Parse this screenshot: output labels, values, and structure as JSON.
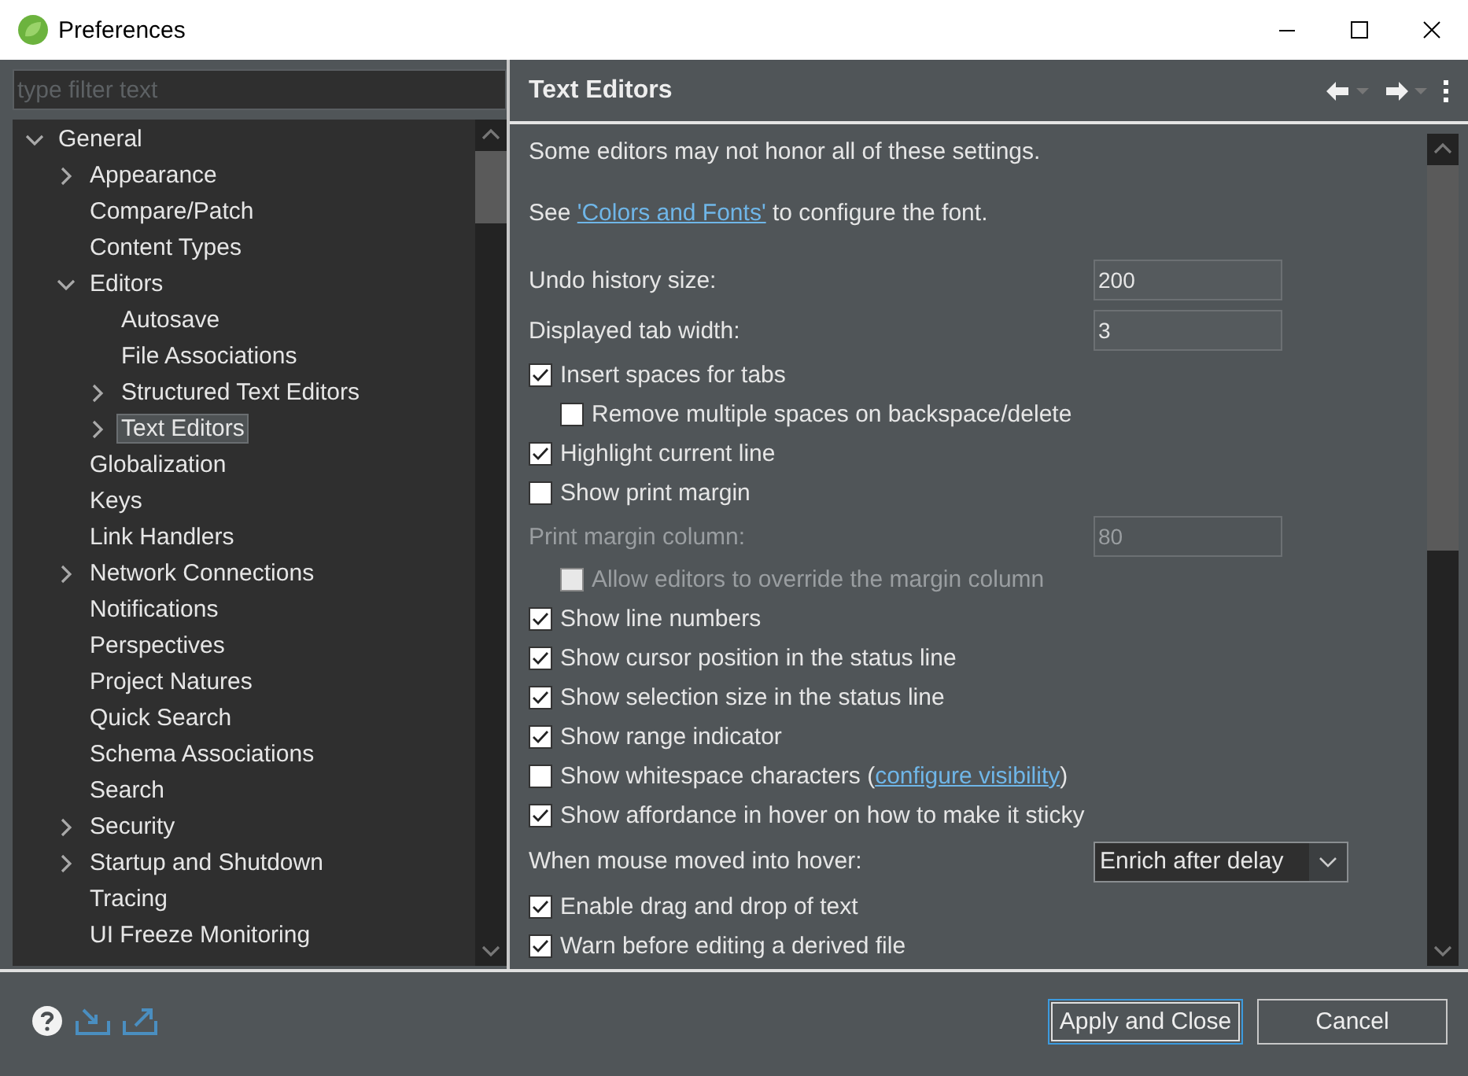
{
  "window": {
    "title": "Preferences"
  },
  "filter": {
    "placeholder": "type filter text"
  },
  "tree": [
    {
      "label": "General",
      "expanded": true,
      "selected": false,
      "children": [
        {
          "label": "Appearance",
          "expanded": false,
          "selected": false
        },
        {
          "label": "Compare/Patch",
          "selected": false
        },
        {
          "label": "Content Types",
          "selected": false
        },
        {
          "label": "Editors",
          "expanded": true,
          "selected": false,
          "children": [
            {
              "label": "Autosave",
              "selected": false
            },
            {
              "label": "File Associations",
              "selected": false
            },
            {
              "label": "Structured Text Editors",
              "expanded": false,
              "selected": false
            },
            {
              "label": "Text Editors",
              "expanded": false,
              "selected": true
            }
          ]
        },
        {
          "label": "Globalization",
          "selected": false
        },
        {
          "label": "Keys",
          "selected": false
        },
        {
          "label": "Link Handlers",
          "selected": false
        },
        {
          "label": "Network Connections",
          "expanded": false,
          "selected": false
        },
        {
          "label": "Notifications",
          "selected": false
        },
        {
          "label": "Perspectives",
          "selected": false
        },
        {
          "label": "Project Natures",
          "selected": false
        },
        {
          "label": "Quick Search",
          "selected": false
        },
        {
          "label": "Schema Associations",
          "selected": false
        },
        {
          "label": "Search",
          "selected": false
        },
        {
          "label": "Security",
          "expanded": false,
          "selected": false
        },
        {
          "label": "Startup and Shutdown",
          "expanded": false,
          "selected": false
        },
        {
          "label": "Tracing",
          "selected": false
        },
        {
          "label": "UI Freeze Monitoring",
          "selected": false
        }
      ]
    }
  ],
  "page": {
    "title": "Text Editors",
    "settings": [
      {
        "kind": "note",
        "text": "Some editors may not honor all of these settings."
      },
      {
        "kind": "note",
        "text": "See ",
        "link": "'Colors and Fonts'",
        "after": " to configure the font."
      },
      {
        "kind": "number",
        "label": "Undo history size:",
        "value": "200",
        "disabled": false
      },
      {
        "kind": "number",
        "label": "Displayed tab width:",
        "value": "3",
        "disabled": false
      },
      {
        "kind": "check",
        "label": "Insert spaces for tabs",
        "checked": true,
        "disabled": false,
        "indented": false
      },
      {
        "kind": "check",
        "label": "Remove multiple spaces on backspace/delete",
        "checked": false,
        "disabled": false,
        "indented": true
      },
      {
        "kind": "check",
        "label": "Highlight current line",
        "checked": true,
        "disabled": false,
        "indented": false
      },
      {
        "kind": "check",
        "label": "Show print margin",
        "checked": false,
        "disabled": false,
        "indented": false
      },
      {
        "kind": "number",
        "label": "Print margin column:",
        "value": "80",
        "disabled": true
      },
      {
        "kind": "check",
        "label": "Allow editors to override the margin column",
        "checked": false,
        "disabled": true,
        "indented": true
      },
      {
        "kind": "check",
        "label": "Show line numbers",
        "checked": true,
        "disabled": false,
        "indented": false
      },
      {
        "kind": "check",
        "label": "Show cursor position in the status line",
        "checked": true,
        "disabled": false,
        "indented": false
      },
      {
        "kind": "check",
        "label": "Show selection size in the status line",
        "checked": true,
        "disabled": false,
        "indented": false
      },
      {
        "kind": "check",
        "label": "Show range indicator",
        "checked": true,
        "disabled": false,
        "indented": false
      },
      {
        "kind": "check",
        "label": "Show whitespace characters (",
        "link": "configure visibility",
        "after": ")",
        "checked": false,
        "disabled": false,
        "indented": false
      },
      {
        "kind": "check",
        "label": "Show affordance in hover on how to make it sticky",
        "checked": true,
        "disabled": false,
        "indented": false
      },
      {
        "kind": "select",
        "label": "When mouse moved into hover:",
        "value": "Enrich after delay"
      },
      {
        "kind": "check",
        "label": "Enable drag and drop of text",
        "checked": true,
        "disabled": false,
        "indented": false
      },
      {
        "kind": "check",
        "label": "Warn before editing a derived file",
        "checked": true,
        "disabled": false,
        "indented": false
      }
    ]
  },
  "buttons": [
    {
      "label": "Apply and Close",
      "kind": "default"
    },
    {
      "label": "Cancel",
      "kind": "normal"
    }
  ]
}
